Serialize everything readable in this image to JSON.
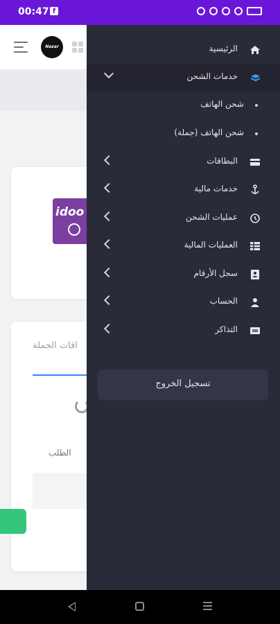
{
  "status_bar": {
    "time": "00:47"
  },
  "background_page": {
    "logo_text": "Nezar",
    "bulk_cards_tab_label": "اقات الجملة",
    "order_label": "الطلب",
    "card_brand": "idoo"
  },
  "drawer": {
    "items": [
      {
        "label": "الرئيسية",
        "icon": "home-icon"
      },
      {
        "label": "خدمات الشحن",
        "icon": "layers-icon",
        "expanded": true
      },
      {
        "label": "البطاقات",
        "icon": "card-icon"
      },
      {
        "label": "خدمات مالية",
        "icon": "anchor-icon"
      },
      {
        "label": "عمليات الشحن",
        "icon": "history-icon"
      },
      {
        "label": "العمليات المالية",
        "icon": "table-icon"
      },
      {
        "label": "سجل الأرقام",
        "icon": "contacts-icon"
      },
      {
        "label": "الحساب",
        "icon": "user-icon"
      },
      {
        "label": "التذاكر",
        "icon": "ticket-icon"
      }
    ],
    "subitems": [
      {
        "label": "شحن الهاتف"
      },
      {
        "label": "شحن الهاتف (جملة)"
      }
    ],
    "logout_label": "تسجيل الخروج"
  },
  "colors": {
    "status_bar": "#6a16d8",
    "drawer_bg": "#2a2b38",
    "accent_blue": "#3b82f6",
    "green": "#34c77b"
  }
}
